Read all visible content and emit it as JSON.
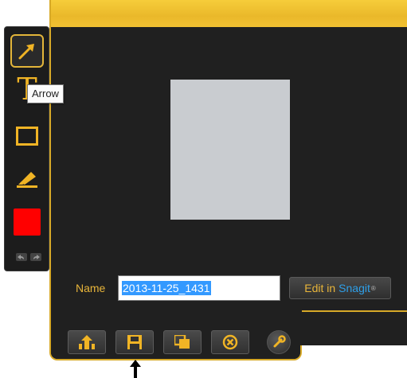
{
  "tooltip": {
    "text": "Arrow"
  },
  "toolbar": {
    "tools": [
      {
        "name": "arrow",
        "icon": "arrow-icon",
        "selected": true
      },
      {
        "name": "text",
        "icon": "text-tool-icon",
        "glyph": "T"
      },
      {
        "name": "shape",
        "icon": "rectangle-icon"
      },
      {
        "name": "highlighter",
        "icon": "highlighter-icon"
      },
      {
        "name": "color",
        "icon": "color-swatch",
        "color": "#ff0000"
      }
    ],
    "undo_icon": "undo-icon",
    "redo_icon": "redo-icon"
  },
  "name_row": {
    "label": "Name",
    "value": "2013-11-25_1431"
  },
  "edit_button": {
    "text_part1": "Edit in",
    "text_part2": "Snagit",
    "mark": "®"
  },
  "actions": [
    {
      "name": "share-button",
      "icon": "share-icon"
    },
    {
      "name": "save-button",
      "icon": "save-icon"
    },
    {
      "name": "copy-button",
      "icon": "copy-icon"
    },
    {
      "name": "delete-button",
      "icon": "delete-icon"
    },
    {
      "name": "settings-button",
      "icon": "wrench-icon"
    }
  ],
  "colors": {
    "accent": "#f0b425",
    "panel": "#202020",
    "link": "#2e9fe8",
    "swatch": "#ff0000"
  }
}
